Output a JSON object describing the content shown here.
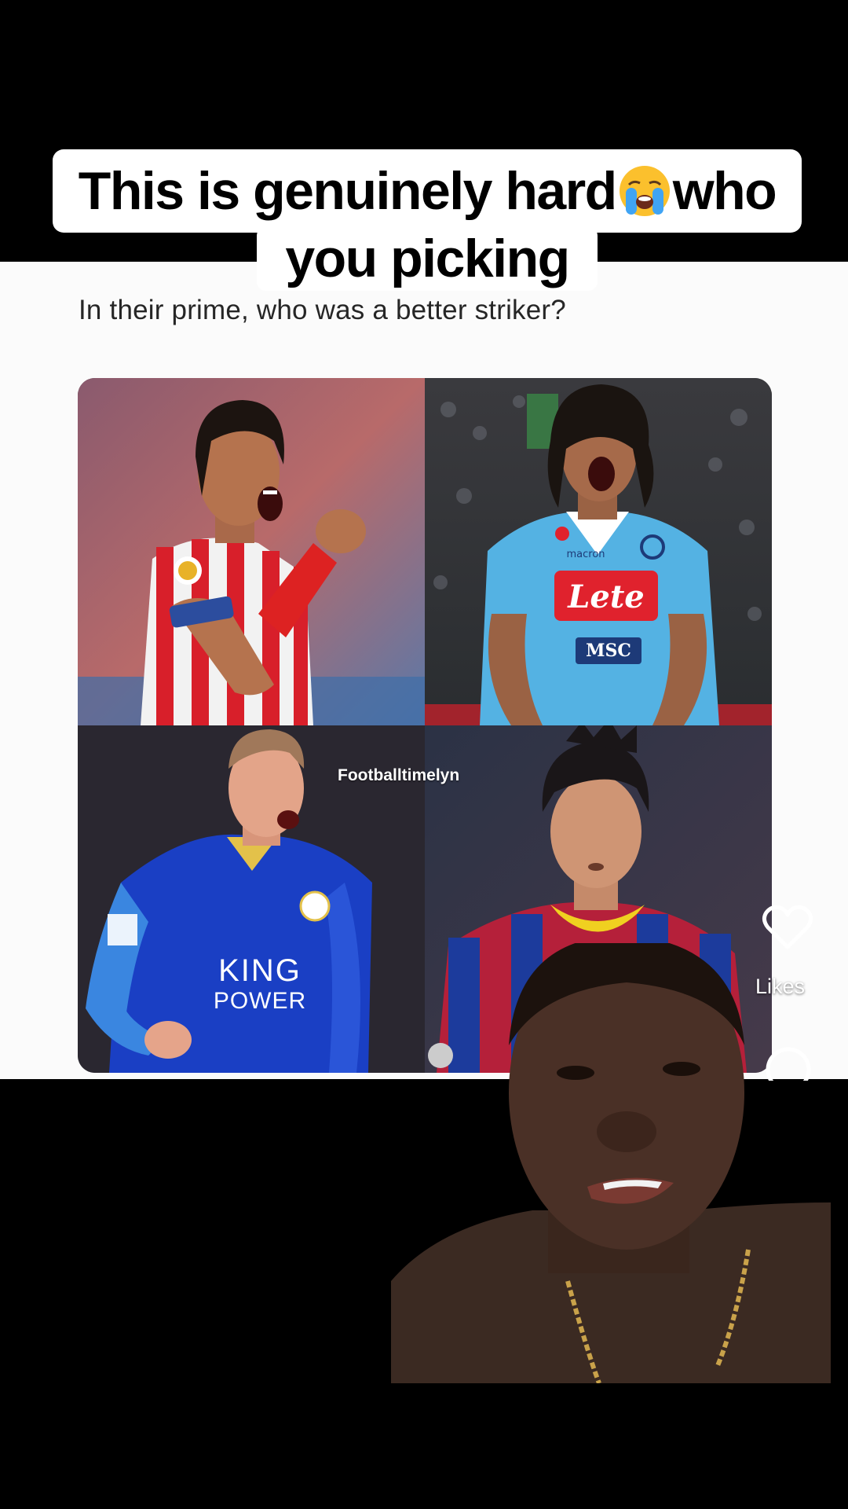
{
  "caption": {
    "line1_before_emoji": "This is genuinely hard",
    "emoji": "crying-face-emoji",
    "line1_after_emoji": "who",
    "line2": "you picking"
  },
  "post": {
    "question": "In their prime, who was a better striker?",
    "watermark": "Footballtimelyn"
  },
  "players": [
    {
      "jersey": "red-white-stripes",
      "sponsor_text": "",
      "badge": "LFP"
    },
    {
      "jersey": "sky-blue",
      "sponsor_text": "Lete",
      "sub_sponsor": "MSC",
      "kit_brand": "macron"
    },
    {
      "jersey": "royal-blue",
      "sponsor_text": "KING POWER"
    },
    {
      "jersey": "blue-red-stripes",
      "sponsor_text": ""
    }
  ],
  "actions": {
    "likes_label": "Likes",
    "like_icon": "heart-outline-icon",
    "comment_icon": "comment-bubble-icon"
  },
  "colors": {
    "background": "#000000",
    "caption_bg": "#ffffff",
    "caption_text": "#000000",
    "screenshot_bg": "#fbfbfb"
  }
}
